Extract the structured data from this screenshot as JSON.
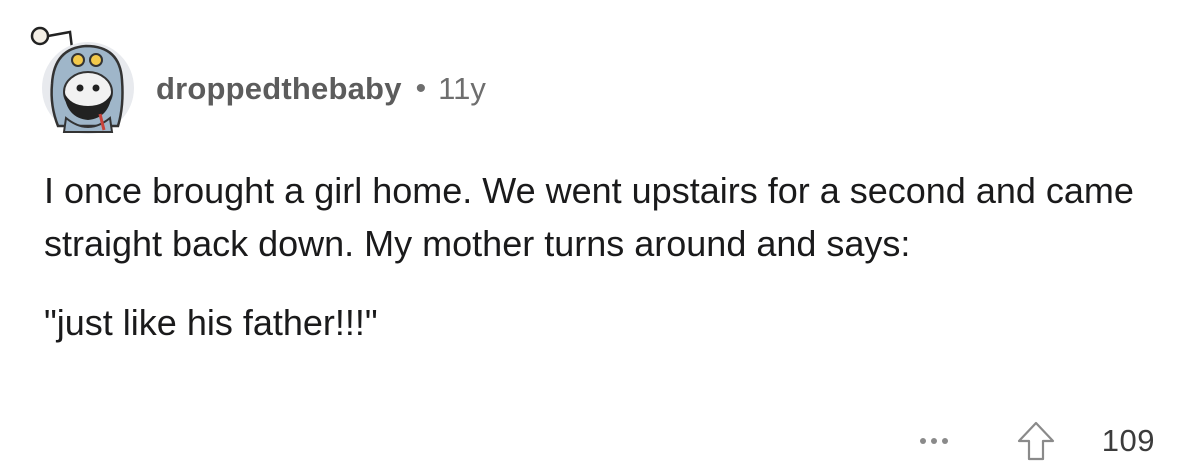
{
  "comment": {
    "username": "droppedthebaby",
    "separator": "•",
    "age": "11y",
    "body_paragraphs": [
      "I once brought a girl home. We went upstairs for a second and came straight back down. My mother turns around and says:",
      "\"just like his father!!!\""
    ],
    "avatar_icon": "snoo-avatar-icon",
    "more_icon": "ellipsis-icon",
    "upvote_icon": "upvote-arrow-icon",
    "score": "109"
  },
  "colors": {
    "text": "#1a1a1b",
    "meta": "#6e6e6e",
    "icon": "#8a8a8a"
  }
}
